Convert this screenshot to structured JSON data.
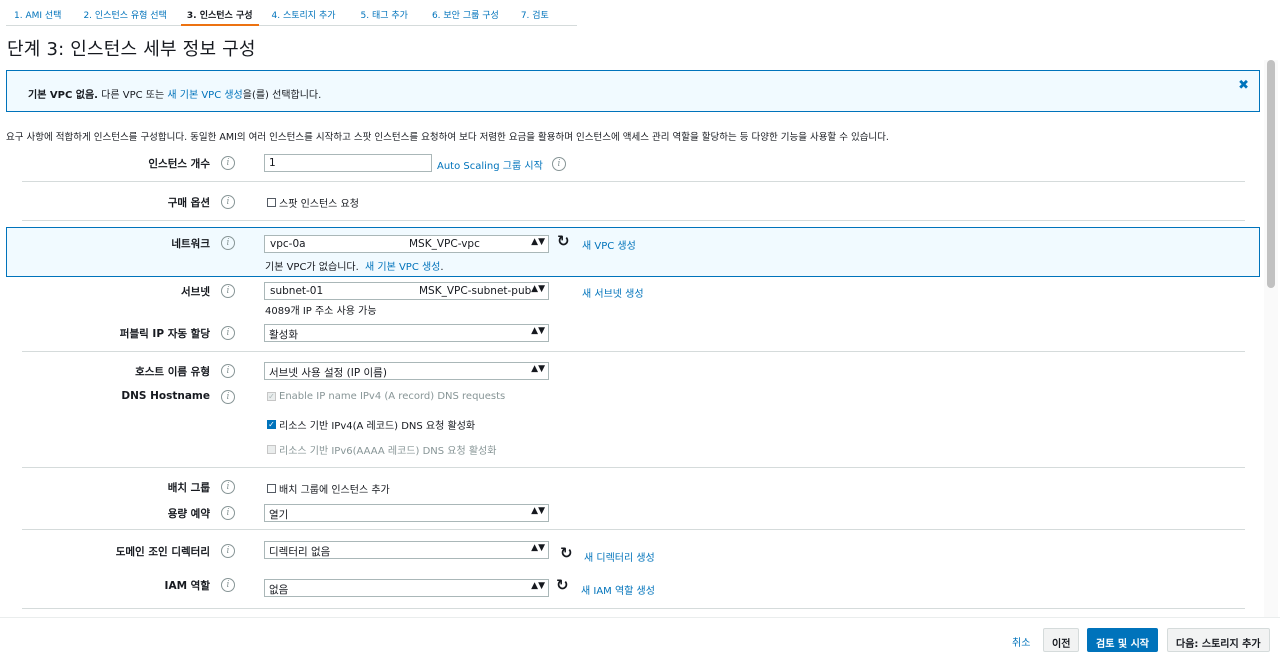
{
  "wizard": {
    "steps": [
      {
        "label": "1. AMI 선택"
      },
      {
        "label": "2. 인스턴스 유형 선택"
      },
      {
        "label": "3. 인스턴스 구성"
      },
      {
        "label": "4. 스토리지 추가"
      },
      {
        "label": "5. 태그 추가"
      },
      {
        "label": "6. 보안 그룹 구성"
      },
      {
        "label": "7. 검토"
      }
    ],
    "active_step": 3
  },
  "page": {
    "title": "단계 3: 인스턴스 세부 정보 구성"
  },
  "alert": {
    "bold": "기본 VPC 없음.",
    "text_before": " 다른 VPC 또는 ",
    "link": "새 기본 VPC 생성",
    "text_after": "을(를) 선택합니다.",
    "close": "✖"
  },
  "description": "요구 사항에 적합하게 인스턴스를 구성합니다. 동일한 AMI의 여러 인스턴스를 시작하고 스팟 인스턴스를 요청하여 보다 저렴한 요금을 활용하며 인스턴스에 액세스 관리 역할을 할당하는 등 다양한 기능을 사용할 수 있습니다.",
  "form": {
    "instance_count": {
      "label": "인스턴스 개수",
      "value": "1",
      "link": "Auto Scaling 그룹 시작"
    },
    "purchase_option": {
      "label": "구매 옵션",
      "checkbox": "스팟 인스턴스 요청",
      "checked": false
    },
    "network": {
      "label": "네트워크",
      "vpc_id": "vpc-0a",
      "vpc_name": "MSK_VPC-vpc",
      "new_link": "새 VPC 생성",
      "note_text": "기본 VPC가 없습니다.",
      "note_link": "새 기본 VPC 생성",
      "note_period": "."
    },
    "subnet": {
      "label": "서브넷",
      "subnet_id": "subnet-01",
      "subnet_name": "MSK_VPC-subnet-pub",
      "new_link": "새 서브넷 생성",
      "available": "4089개 IP 주소 사용 가능"
    },
    "public_ip": {
      "label": "퍼블릭 IP 자동 할당",
      "value": "활성화"
    },
    "hostname_type": {
      "label": "호스트 이름 유형",
      "value": "서브넷 사용 설정 (IP 이름)"
    },
    "dns_hostname": {
      "label": "DNS Hostname",
      "options": [
        {
          "text": "Enable IP name IPv4 (A record) DNS requests",
          "checked": true,
          "disabled": true
        },
        {
          "text": "리소스 기반 IPv4(A 레코드) DNS 요청 활성화",
          "checked": true,
          "disabled": false
        },
        {
          "text": "리소스 기반 IPv6(AAAA 레코드) DNS 요청 활성화",
          "checked": false,
          "disabled": true
        }
      ]
    },
    "placement_group": {
      "label": "배치 그룹",
      "checkbox": "배치 그룹에 인스턴스 추가",
      "checked": false
    },
    "capacity_reservation": {
      "label": "용량 예약",
      "value": "열기"
    },
    "domain_join": {
      "label": "도메인 조인 디렉터리",
      "value": "디렉터리 없음",
      "new_link": "새 디렉터리 생성"
    },
    "iam_role": {
      "label": "IAM 역할",
      "value": "없음",
      "new_link": "새 IAM 역할 생성"
    }
  },
  "footer": {
    "cancel": "취소",
    "previous": "이전",
    "review_launch": "검토 및 시작",
    "next": "다음: 스토리지 추가"
  },
  "colors": {
    "accent": "#0073bb",
    "active_tab": "#ec7211",
    "info_bg": "#f1faff"
  }
}
